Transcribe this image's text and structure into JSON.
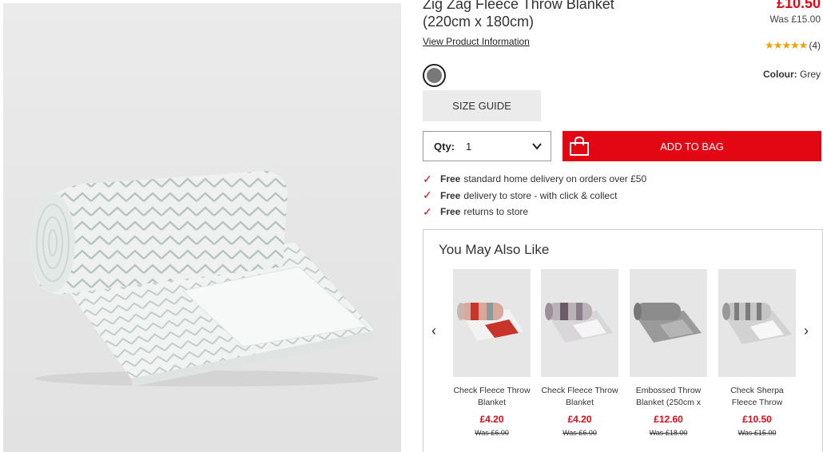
{
  "product": {
    "title_line1": "Zig Zag Fleece Throw Blanket",
    "title_line2": "(220cm x 180cm)",
    "price": "£10.50",
    "was_price": "Was £15.00",
    "view_info_link": "View Product Information",
    "rating_stars": 5,
    "review_count": "(4)",
    "colour_label": "Colour:",
    "colour_value": "Grey",
    "swatch_color": "#787878",
    "size_guide_label": "SIZE GUIDE",
    "qty_label": "Qty:",
    "qty_value": "1",
    "add_to_bag_label": "ADD TO BAG",
    "accent_color": "#e30613"
  },
  "delivery": [
    {
      "bold": "Free",
      "text": "standard home delivery on orders over £50"
    },
    {
      "bold": "Free",
      "text": "delivery to store - with click & collect"
    },
    {
      "bold": "Free",
      "text": "returns to store"
    }
  ],
  "recommendations": {
    "title": "You May Also Like",
    "items": [
      {
        "name": "Check Fleece Throw Blanket",
        "price": "£4.20",
        "was": "Was £6.00"
      },
      {
        "name": "Check Fleece Throw Blanket",
        "price": "£4.20",
        "was": "Was £6.00"
      },
      {
        "name": "Embossed Throw Blanket (250cm x",
        "price": "£12.60",
        "was": "Was £18.00"
      },
      {
        "name": "Check Sherpa Fleece Throw",
        "price": "£10.50",
        "was": "Was £15.00"
      }
    ]
  }
}
